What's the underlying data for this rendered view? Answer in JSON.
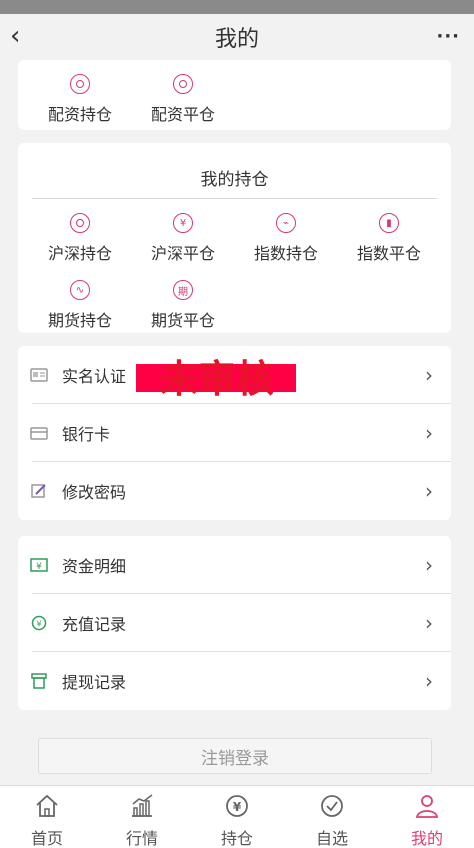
{
  "nav": {
    "title": "我的",
    "back_icon": "chevron-left-icon",
    "more_icon": "more-icon"
  },
  "margin_card": {
    "items": [
      {
        "label": "配资持仓"
      },
      {
        "label": "配资平仓"
      }
    ]
  },
  "holdings": {
    "title": "我的持仓",
    "items": [
      {
        "label": "沪深持仓",
        "glyph": "◎"
      },
      {
        "label": "沪深平仓",
        "glyph": "¥"
      },
      {
        "label": "指数持仓",
        "glyph": "⌁"
      },
      {
        "label": "指数平仓",
        "glyph": "▮"
      },
      {
        "label": "期货持仓",
        "glyph": "∿"
      },
      {
        "label": "期货平仓",
        "glyph": "期"
      }
    ]
  },
  "account": {
    "items": [
      {
        "label": "实名认证",
        "status": "未审核"
      },
      {
        "label": "银行卡"
      },
      {
        "label": "修改密码"
      }
    ]
  },
  "records": {
    "items": [
      {
        "label": "资金明细"
      },
      {
        "label": "充值记录"
      },
      {
        "label": "提现记录"
      }
    ]
  },
  "logout_label": "注销登录",
  "tabs": [
    {
      "label": "首页",
      "icon": "home-icon"
    },
    {
      "label": "行情",
      "icon": "chart-icon"
    },
    {
      "label": "持仓",
      "icon": "yen-icon"
    },
    {
      "label": "自选",
      "icon": "check-icon"
    },
    {
      "label": "我的",
      "icon": "user-icon",
      "active": true
    }
  ],
  "colors": {
    "accent": "#e0406e",
    "icon_red": "#d63a6a",
    "icon_green": "#2e9e5b",
    "stamp": "#e8132b"
  }
}
